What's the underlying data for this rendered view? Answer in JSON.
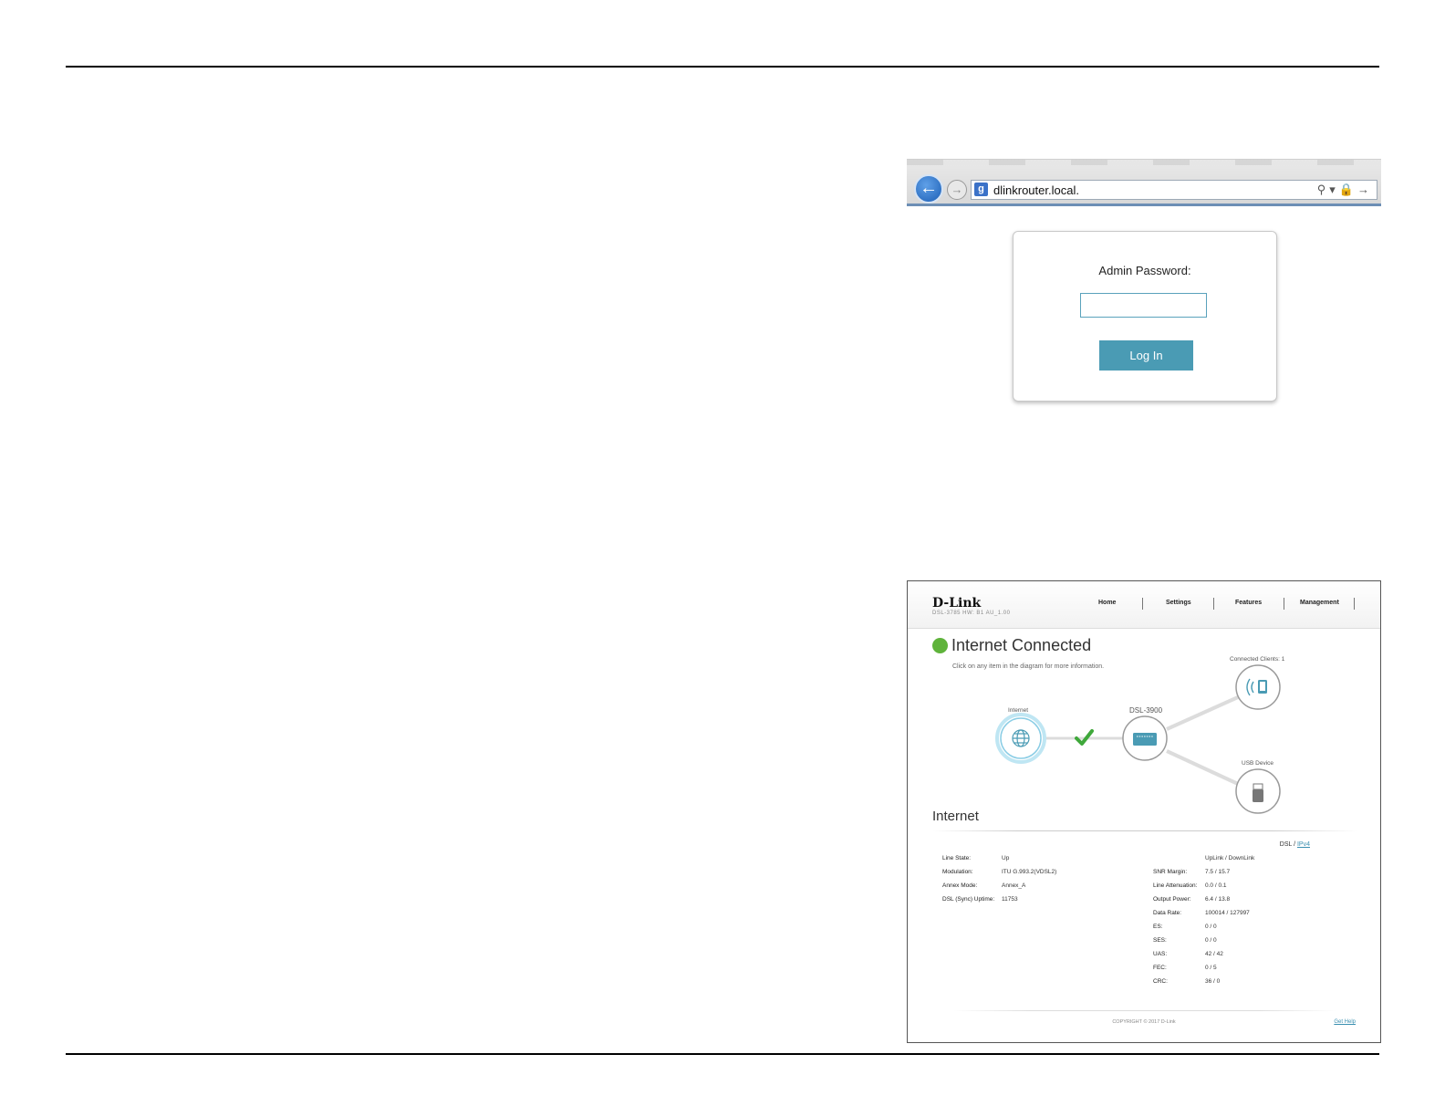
{
  "browser": {
    "url": "dlinkrouter.local.",
    "back_icon": "back-arrow-icon",
    "forward_icon": "forward-arrow-icon",
    "search_icon": "search-icon",
    "lock_icon": "lock-icon"
  },
  "login": {
    "label": "Admin Password:",
    "password_value": "",
    "button_label": "Log In",
    "accent": "#4a9bb4"
  },
  "dashboard": {
    "logo": "D-Link",
    "model": "DSL-3785  HW: B1  AU_1.00",
    "nav": [
      "Home",
      "Settings",
      "Features",
      "Management"
    ],
    "status_title": "Internet Connected",
    "status_color": "#5fb33b",
    "status_hint": "Click on any item in the diagram for more information.",
    "diagram": {
      "internet_label": "Internet",
      "router_label": "DSL-3900",
      "clients_label": "Connected Clients: 1",
      "usb_label": "USB Device"
    },
    "section_title": "Internet",
    "tab_dsl": "DSL",
    "tab_sep": " / ",
    "tab_ipv4": "IPv4",
    "left_rows": [
      {
        "key": "Line State:",
        "value": "Up"
      },
      {
        "key": "Modulation:",
        "value": "ITU G.993.2(VDSL2)"
      },
      {
        "key": "Annex Mode:",
        "value": "Annex_A"
      },
      {
        "key": "DSL (Sync) Uptime:",
        "value": "11753"
      }
    ],
    "right_header": "UpLink / DownLink",
    "right_rows": [
      {
        "key": "SNR Margin:",
        "value": "7.5 / 15.7"
      },
      {
        "key": "Line Attenuation:",
        "value": "0.0 / 0.1"
      },
      {
        "key": "Output Power:",
        "value": "6.4 / 13.8"
      },
      {
        "key": "Data Rate:",
        "value": "100014 / 127997"
      },
      {
        "key": "ES:",
        "value": "0 / 0"
      },
      {
        "key": "SES:",
        "value": "0 / 0"
      },
      {
        "key": "UAS:",
        "value": "42 / 42"
      },
      {
        "key": "FEC:",
        "value": "0 / 5"
      },
      {
        "key": "CRC:",
        "value": "36 / 0"
      }
    ],
    "copyright": "COPYRIGHT © 2017 D-Link",
    "get_help": "Get Help"
  }
}
